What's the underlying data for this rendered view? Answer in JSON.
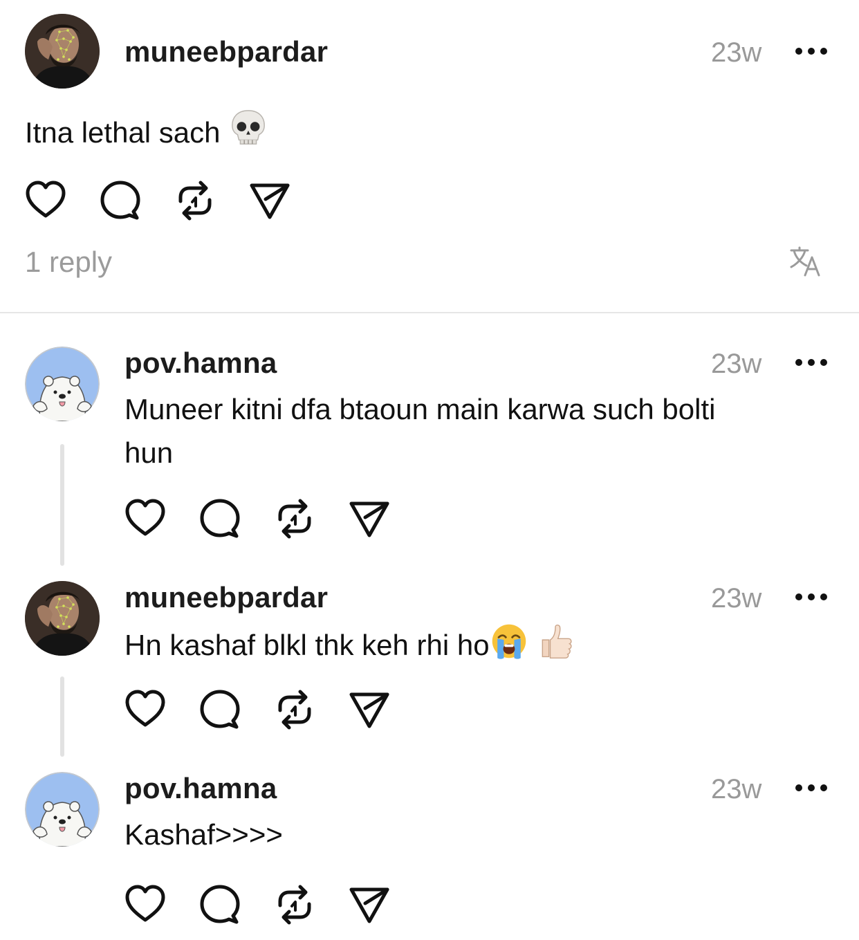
{
  "post": {
    "username": "muneebpardar",
    "time": "23w",
    "text": "Itna lethal sach",
    "reply_count": "1 reply"
  },
  "replies": [
    {
      "username": "pov.hamna",
      "time": "23w",
      "line1": "Muneer kitni dfa btaoun main karwa such bolti",
      "line2": "hun"
    },
    {
      "username": "muneebpardar",
      "time": "23w",
      "text": "Hn kashaf blkl thk keh rhi ho"
    },
    {
      "username": "pov.hamna",
      "time": "23w",
      "text": "Kashaf>>>>"
    }
  ],
  "icons": {
    "like": "heart-icon",
    "comment": "comment-icon",
    "repost": "repost-icon",
    "share": "send-icon",
    "more": "more-icon",
    "translate": "translate-icon"
  },
  "colors": {
    "text": "#111111",
    "muted": "#999999",
    "divider": "#e6e6e6",
    "thread_line": "#e2e2e2",
    "bear_avatar_bg": "#9dbff0"
  }
}
